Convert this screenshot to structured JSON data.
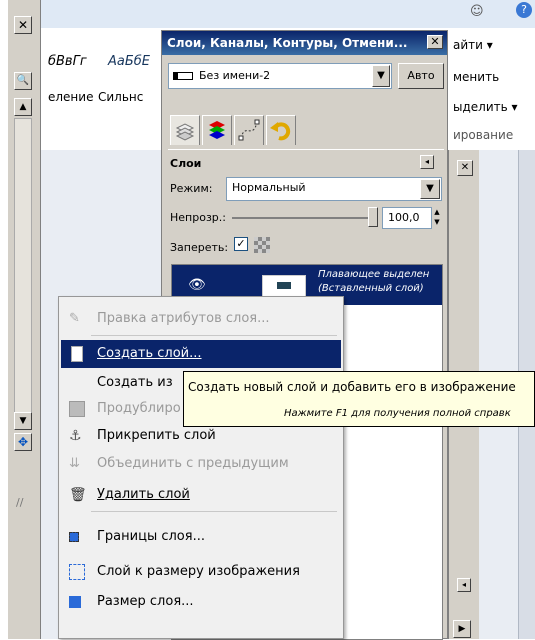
{
  "ribbon": {
    "style_sample_1": "бВвГг",
    "style_sample_2": "АаБбЕ",
    "tab_partial_1": "еление",
    "tab_partial_2": "Сильнс",
    "right_1": "айти ▾",
    "right_2": "менить",
    "right_3": "ыделить ▾",
    "right_4": "ирование"
  },
  "dock": {
    "title": "Слои, Каналы, Контуры, Отмени...",
    "image_name": "Без имени-2",
    "auto_button": "Авто",
    "panel_title": "Слои",
    "mode_label": "Режим:",
    "mode_value": "Нормальный",
    "opacity_label": "Непрозр.:",
    "opacity_value": "100,0",
    "opacity_percent": 100,
    "lock_label": "Запереть:",
    "layer_name_1": "Плавающее выделен",
    "layer_name_2": "(Вставленный слой)"
  },
  "menu": {
    "items": [
      {
        "label": "Правка атрибутов слоя...",
        "icon": "edit-icon",
        "enabled": false
      },
      {
        "label": "Создать слой...",
        "icon": "new-layer-icon",
        "enabled": true
      },
      {
        "label": "Создать из",
        "icon": "",
        "enabled": true
      },
      {
        "label": "Продублиро",
        "icon": "duplicate-icon",
        "enabled": false
      },
      {
        "label": "Прикрепить слой",
        "icon": "anchor-icon",
        "enabled": true
      },
      {
        "label": "Объединить с предыдущим",
        "icon": "merge-icon",
        "enabled": false
      },
      {
        "label": "Удалить слой",
        "icon": "trash-icon",
        "enabled": true
      },
      {
        "label": "Границы слоя...",
        "icon": "layer-boundary-icon",
        "enabled": true
      },
      {
        "label": "Слой к размеру изображения",
        "icon": "layer-to-image-size-icon",
        "enabled": true
      },
      {
        "label": "Размер слоя...",
        "icon": "scale-layer-icon",
        "enabled": true
      }
    ]
  },
  "tooltip": {
    "main": "Создать новый слой и добавить его в изображение",
    "hint": "Нажмите F1 для получения полной справк"
  },
  "colors": {
    "highlight": "#0a246a",
    "tooltip_bg": "#ffffe1"
  }
}
